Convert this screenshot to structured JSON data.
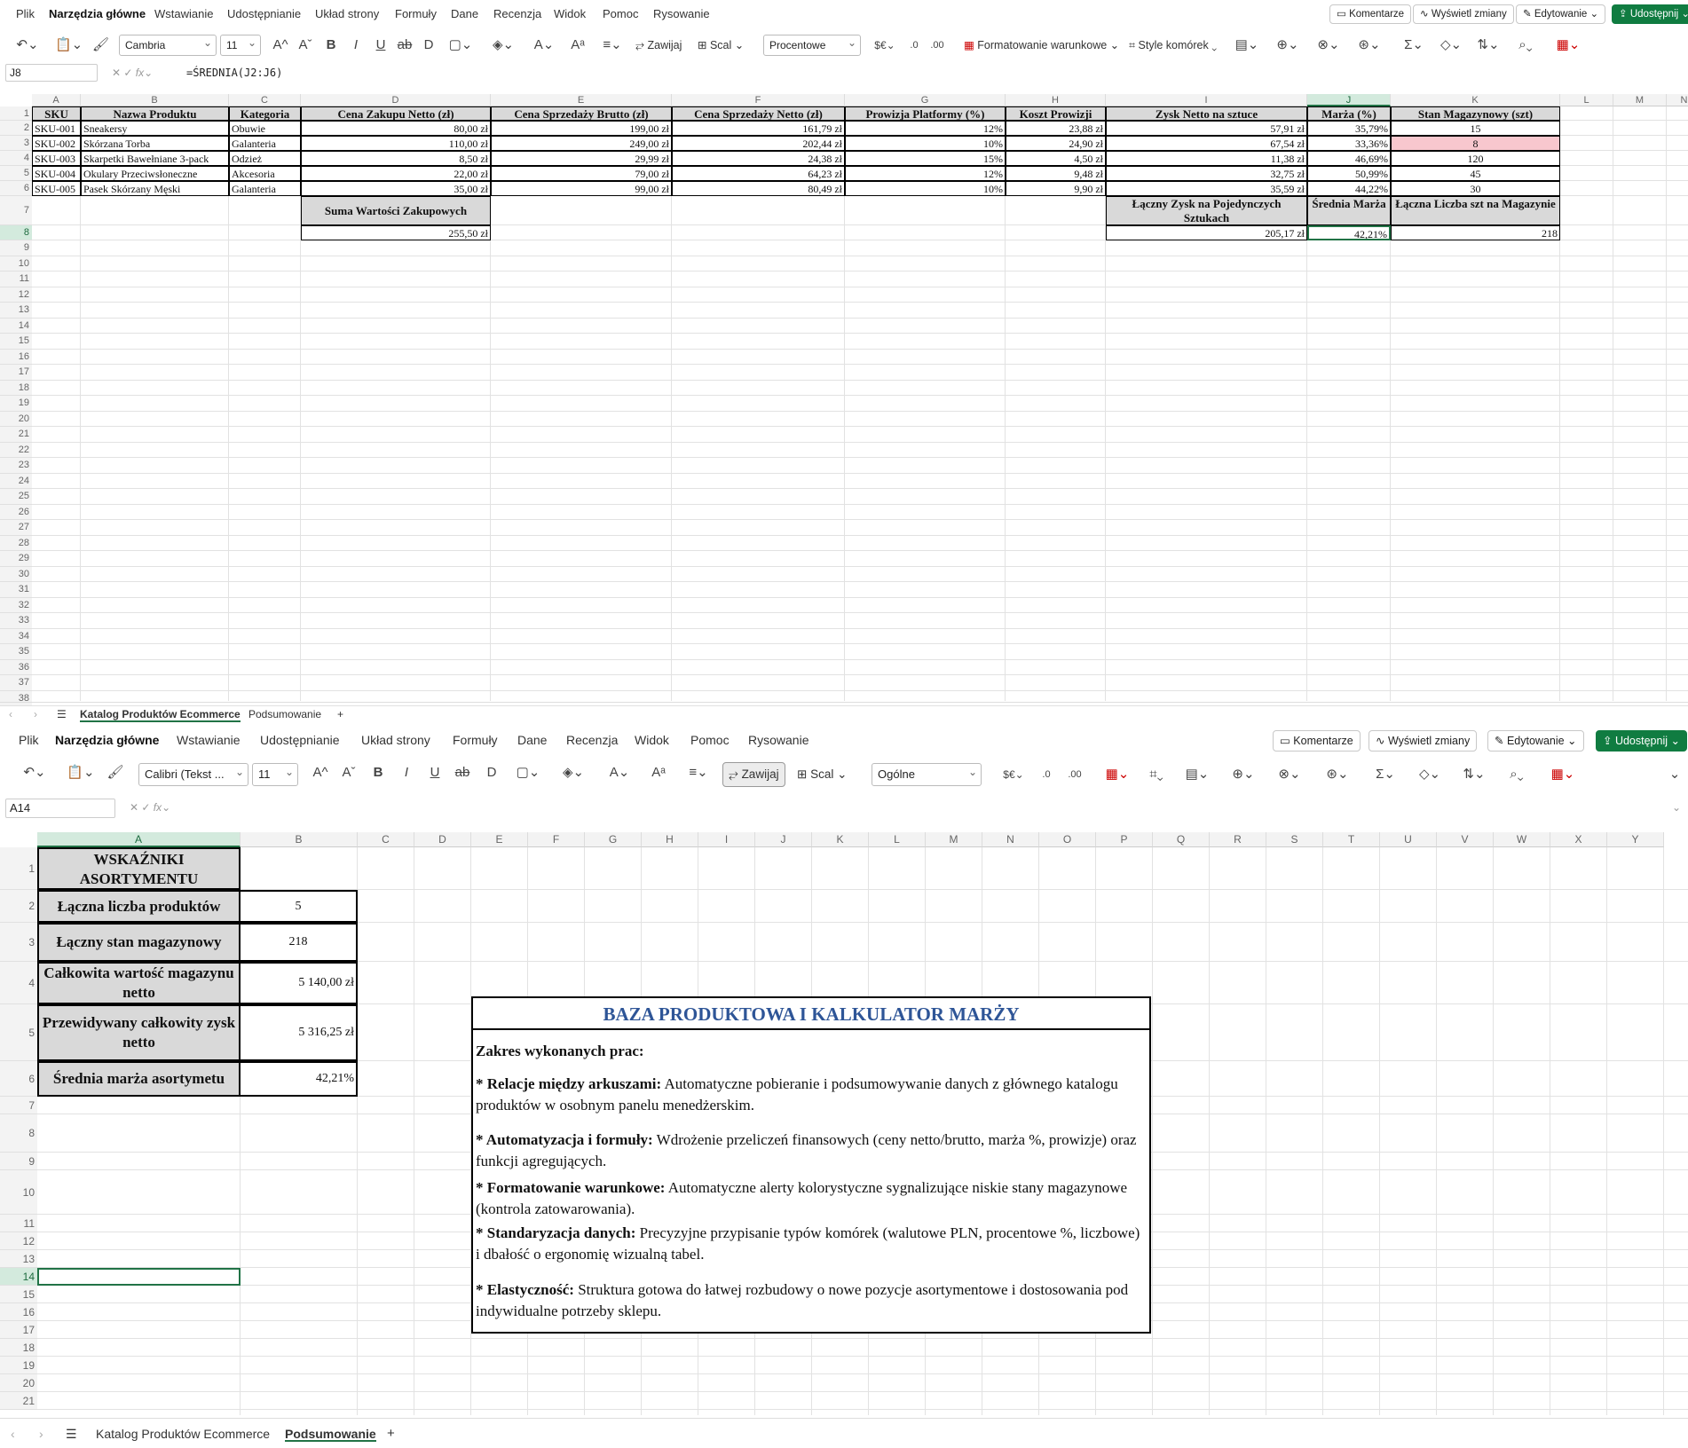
{
  "menu": {
    "items": [
      "Plik",
      "Narzędzia główne",
      "Wstawianie",
      "Udostępnianie",
      "Układ strony",
      "Formuły",
      "Dane",
      "Recenzja",
      "Widok",
      "Pomoc",
      "Rysowanie"
    ],
    "active": "Narzędzia główne"
  },
  "top_buttons": {
    "comments": "Komentarze",
    "changes": "Wyświetl zmiany",
    "editing": "Edytowanie",
    "share": "Udostępnij"
  },
  "ribbon": {
    "wrap": "Zawijaj",
    "merge": "Scal",
    "cond_format": "Formatowanie warunkowe",
    "cell_styles": "Style komórek",
    "currency_symbol": "$€"
  },
  "sheet1": {
    "font": "Cambria",
    "font_size": "11",
    "number_format": "Procentowe",
    "name_box": "J8",
    "formula": "=ŚREDNIA(J2:J6)",
    "col_letters": [
      "A",
      "B",
      "C",
      "D",
      "E",
      "F",
      "G",
      "H",
      "I",
      "J",
      "K",
      "L",
      "M",
      "N"
    ],
    "headers": [
      "SKU",
      "Nazwa Produktu",
      "Kategoria",
      "Cena Zakupu Netto (zł)",
      "Cena Sprzedaży Brutto (zł)",
      "Cena Sprzedaży Netto (zł)",
      "Prowizja Platformy (%)",
      "Koszt Prowizji",
      "Zysk Netto na sztuce",
      "Marża (%)",
      "Stan Magazynowy (szt)"
    ],
    "rows": [
      [
        "SKU-001",
        "Sneakersy",
        "Obuwie",
        "80,00 zł",
        "199,00 zł",
        "161,79 zł",
        "12%",
        "23,88 zł",
        "57,91 zł",
        "35,79%",
        "15"
      ],
      [
        "SKU-002",
        "Skórzana Torba",
        "Galanteria",
        "110,00 zł",
        "249,00 zł",
        "202,44 zł",
        "10%",
        "24,90 zł",
        "67,54 zł",
        "33,36%",
        "8"
      ],
      [
        "SKU-003",
        "Skarpetki Bawełniane 3-pack",
        "Odzież",
        "8,50 zł",
        "29,99 zł",
        "24,38 zł",
        "15%",
        "4,50 zł",
        "11,38 zł",
        "46,69%",
        "120"
      ],
      [
        "SKU-004",
        "Okulary Przeciwsłoneczne",
        "Akcesoria",
        "22,00 zł",
        "79,00 zł",
        "64,23 zł",
        "12%",
        "9,48 zł",
        "32,75 zł",
        "50,99%",
        "45"
      ],
      [
        "SKU-005",
        "Pasek Skórzany Męski",
        "Galanteria",
        "35,00 zł",
        "99,00 zł",
        "80,49 zł",
        "10%",
        "9,90 zł",
        "35,59 zł",
        "44,22%",
        "30"
      ]
    ],
    "low_stock_highlight": "#f8c7ce",
    "summary": {
      "purchase_label": "Suma Wartości Zakupowych",
      "purchase_value": "255,50 zł",
      "profit_label": "Łączny Zysk na Pojedynczych Sztukach",
      "profit_value": "205,17 zł",
      "margin_label": "Średnia Marża",
      "margin_value": "42,21%",
      "stock_label": "Łączna Liczba szt na Magazynie",
      "stock_value": "218"
    },
    "tabs": [
      "Katalog Produktów Ecommerce",
      "Podsumowanie"
    ],
    "active_tab": "Katalog Produktów Ecommerce"
  },
  "sheet2": {
    "font": "Calibri (Tekst ...",
    "font_size": "11",
    "number_format": "Ogólne",
    "name_box": "A14",
    "formula": "",
    "col_letters": [
      "A",
      "B",
      "C",
      "D",
      "E",
      "F",
      "G",
      "H",
      "I",
      "J",
      "K",
      "L",
      "M",
      "N",
      "O",
      "P",
      "Q",
      "R",
      "S",
      "T",
      "U",
      "V",
      "W",
      "X",
      "Y"
    ],
    "indicators_title": "WSKAŹNIKI ASORTYMENTU",
    "indicators": [
      {
        "label": "Łączna liczba produktów",
        "value": "5"
      },
      {
        "label": "Łączny stan magazynowy",
        "value": "218"
      },
      {
        "label": "Całkowita wartość magazynu netto",
        "value": "5 140,00 zł"
      },
      {
        "label": "Przewidywany całkowity zysk netto",
        "value": "5 316,25 zł"
      },
      {
        "label": "Średnia marża asortymetu",
        "value": "42,21%"
      }
    ],
    "panel": {
      "title": "BAZA PRODUKTOWA I KALKULATOR MARŻY",
      "title_color": "#2e5597",
      "subtitle": "Zakres wykonanych prac:",
      "items": [
        {
          "bold": "* Relacje między arkuszami:",
          "text": " Automatyczne pobieranie i podsumowywanie danych z głównego katalogu produktów w osobnym panelu menedżerskim."
        },
        {
          "bold": "* Automatyzacja i formuły:",
          "text": " Wdrożenie przeliczeń finansowych (ceny netto/brutto, marża %, prowizje) oraz funkcji agregujących."
        },
        {
          "bold": "* Formatowanie warunkowe:",
          "text": " Automatyczne alerty kolorystyczne sygnalizujące niskie stany magazynowe (kontrola zatowarowania)."
        },
        {
          "bold": "* Standaryzacja danych:",
          "text": " Precyzyjne przypisanie typów komórek (walutowe PLN, procentowe %, liczbowe) i dbałość o ergonomię wizualną tabel."
        },
        {
          "bold": "* Elastyczność:",
          "text": " Struktura gotowa do łatwej rozbudowy o nowe pozycje asortymentowe i dostosowania pod indywidualne potrzeby sklepu."
        }
      ]
    },
    "tabs": [
      "Katalog Produktów Ecommerce",
      "Podsumowanie"
    ],
    "active_tab": "Podsumowanie"
  }
}
